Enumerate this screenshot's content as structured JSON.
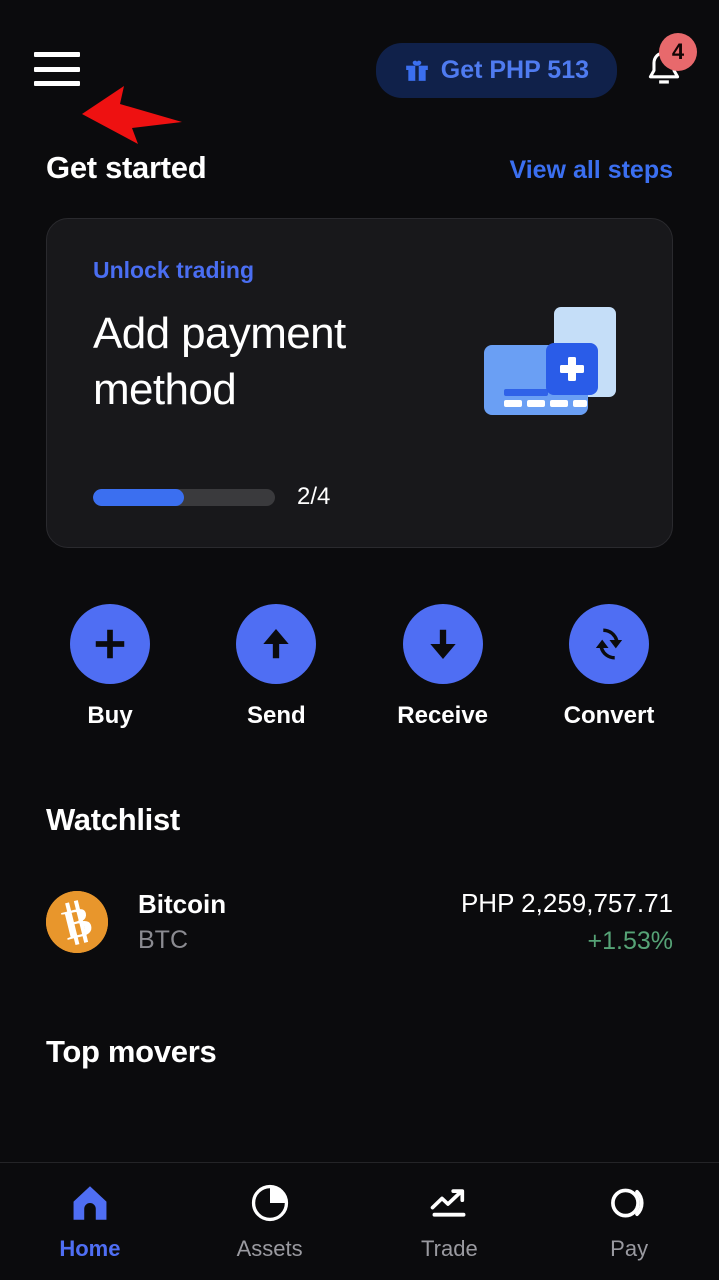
{
  "theme": {
    "background": "#0b0b0d",
    "card_background": "#18181b",
    "accent_blue": "#4f6ef3",
    "link_blue": "#3b6ff0",
    "promo_pill_background": "#10214a",
    "badge_red": "#e8696c",
    "positive_green": "#56a376",
    "bitcoin_orange": "#e8962c",
    "annotation_red": "#ee1111"
  },
  "header": {
    "menu_icon": "hamburger-menu-icon",
    "promo": {
      "icon": "gift-icon",
      "label": "Get PHP 513"
    },
    "notifications": {
      "icon": "bell-icon",
      "badge_count": "4"
    },
    "annotation": {
      "icon": "red-arrow-annotation",
      "points_to": "hamburger-menu-icon"
    }
  },
  "get_started": {
    "title": "Get started",
    "view_all_label": "View all steps",
    "card": {
      "kicker": "Unlock trading",
      "title": "Add payment method",
      "progress_label": "2/4",
      "progress_current": 2,
      "progress_total": 4,
      "progress_percent": 50,
      "illustration": "add-payment-card-illustration"
    }
  },
  "quick_actions": [
    {
      "label": "Buy",
      "icon": "plus-icon"
    },
    {
      "label": "Send",
      "icon": "arrow-up-icon"
    },
    {
      "label": "Receive",
      "icon": "arrow-down-icon"
    },
    {
      "label": "Convert",
      "icon": "convert-refresh-icon"
    }
  ],
  "watchlist": {
    "title": "Watchlist",
    "items": [
      {
        "name": "Bitcoin",
        "ticker": "BTC",
        "icon": "bitcoin-icon",
        "price": "PHP 2,259,757.71",
        "change": "+1.53%",
        "change_direction": "up"
      }
    ]
  },
  "top_movers": {
    "title": "Top movers"
  },
  "bottom_nav": {
    "items": [
      {
        "label": "Home",
        "icon": "home-icon",
        "active": true
      },
      {
        "label": "Assets",
        "icon": "pie-chart-icon",
        "active": false
      },
      {
        "label": "Trade",
        "icon": "trending-up-icon",
        "active": false
      },
      {
        "label": "Pay",
        "icon": "coinbase-pay-icon",
        "active": false
      }
    ]
  }
}
